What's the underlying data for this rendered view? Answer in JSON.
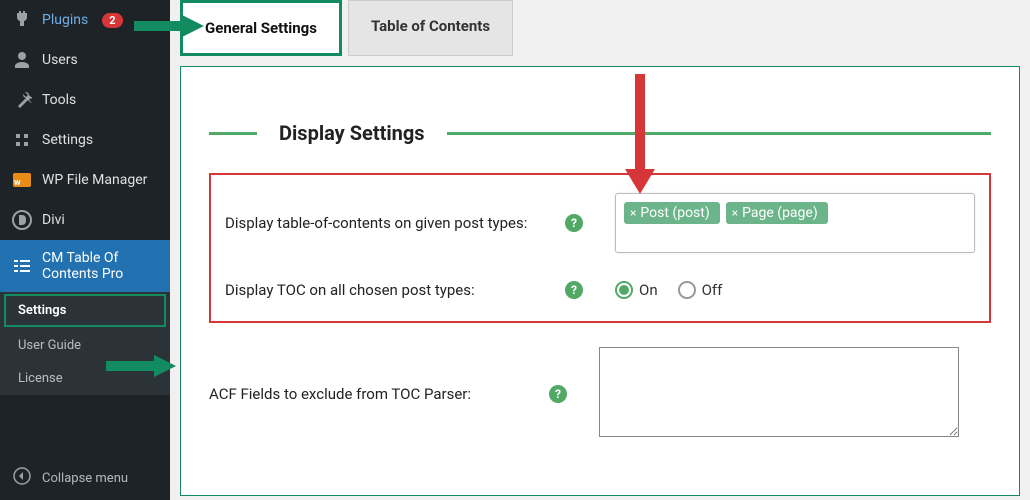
{
  "sidebar": {
    "items": [
      {
        "label": "Plugins",
        "badge": "2"
      },
      {
        "label": "Users"
      },
      {
        "label": "Tools"
      },
      {
        "label": "Settings"
      },
      {
        "label": "WP File Manager"
      },
      {
        "label": "Divi"
      },
      {
        "label": "CM Table Of Contents Pro"
      }
    ],
    "submenu": [
      {
        "label": "Settings"
      },
      {
        "label": "User Guide"
      },
      {
        "label": "License"
      }
    ],
    "collapse": "Collapse menu"
  },
  "tabs": {
    "general": "General Settings",
    "toc": "Table of Contents"
  },
  "section": {
    "title": "Display Settings"
  },
  "fields": {
    "post_types": {
      "label": "Display table-of-contents on given post types:",
      "tokens": [
        "Post (post)",
        "Page (page)"
      ]
    },
    "display_all": {
      "label": "Display TOC on all chosen post types:",
      "on": "On",
      "off": "Off"
    },
    "acf": {
      "label": "ACF Fields to exclude from TOC Parser:"
    }
  },
  "help_glyph": "?"
}
